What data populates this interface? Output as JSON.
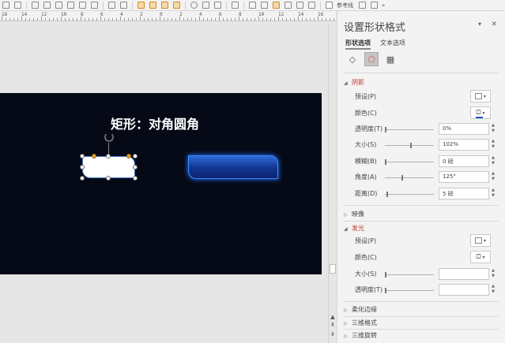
{
  "toolbar": {
    "ref_line_label": "参考线"
  },
  "ruler": {
    "numbers": [
      "16",
      "14",
      "12",
      "10",
      "8",
      "6",
      "4",
      "2",
      "0",
      "2",
      "4",
      "6",
      "8",
      "10",
      "12",
      "14",
      "16"
    ]
  },
  "slide": {
    "title": "矩形：对角圆角"
  },
  "panel": {
    "title": "设置形状格式",
    "tab_shape": "形状选项",
    "tab_text": "文本选项",
    "shadow": {
      "header": "阴影",
      "preset_label": "预设(P)",
      "color_label": "颜色(C)",
      "transparency_label": "透明度(T)",
      "transparency_value": "0%",
      "size_label": "大小(S)",
      "size_value": "102%",
      "blur_label": "模糊(B)",
      "blur_value": "0 磅",
      "angle_label": "角度(A)",
      "angle_value": "125°",
      "distance_label": "距离(D)",
      "distance_value": "5 磅"
    },
    "reflection_header": "映像",
    "glow": {
      "header": "发光",
      "preset_label": "预设(P)",
      "color_label": "颜色(C)",
      "size_label": "大小(S)",
      "size_value": "",
      "transparency_label": "透明度(T)",
      "transparency_value": ""
    },
    "soft_edges_header": "柔化边缘",
    "format_3d_header": "三维格式",
    "rotation_3d_header": "三维旋转"
  },
  "colors": {
    "slide_bg": "#060a17",
    "accent_red": "#c0392b",
    "glow_blue": "#1d5fd6"
  }
}
